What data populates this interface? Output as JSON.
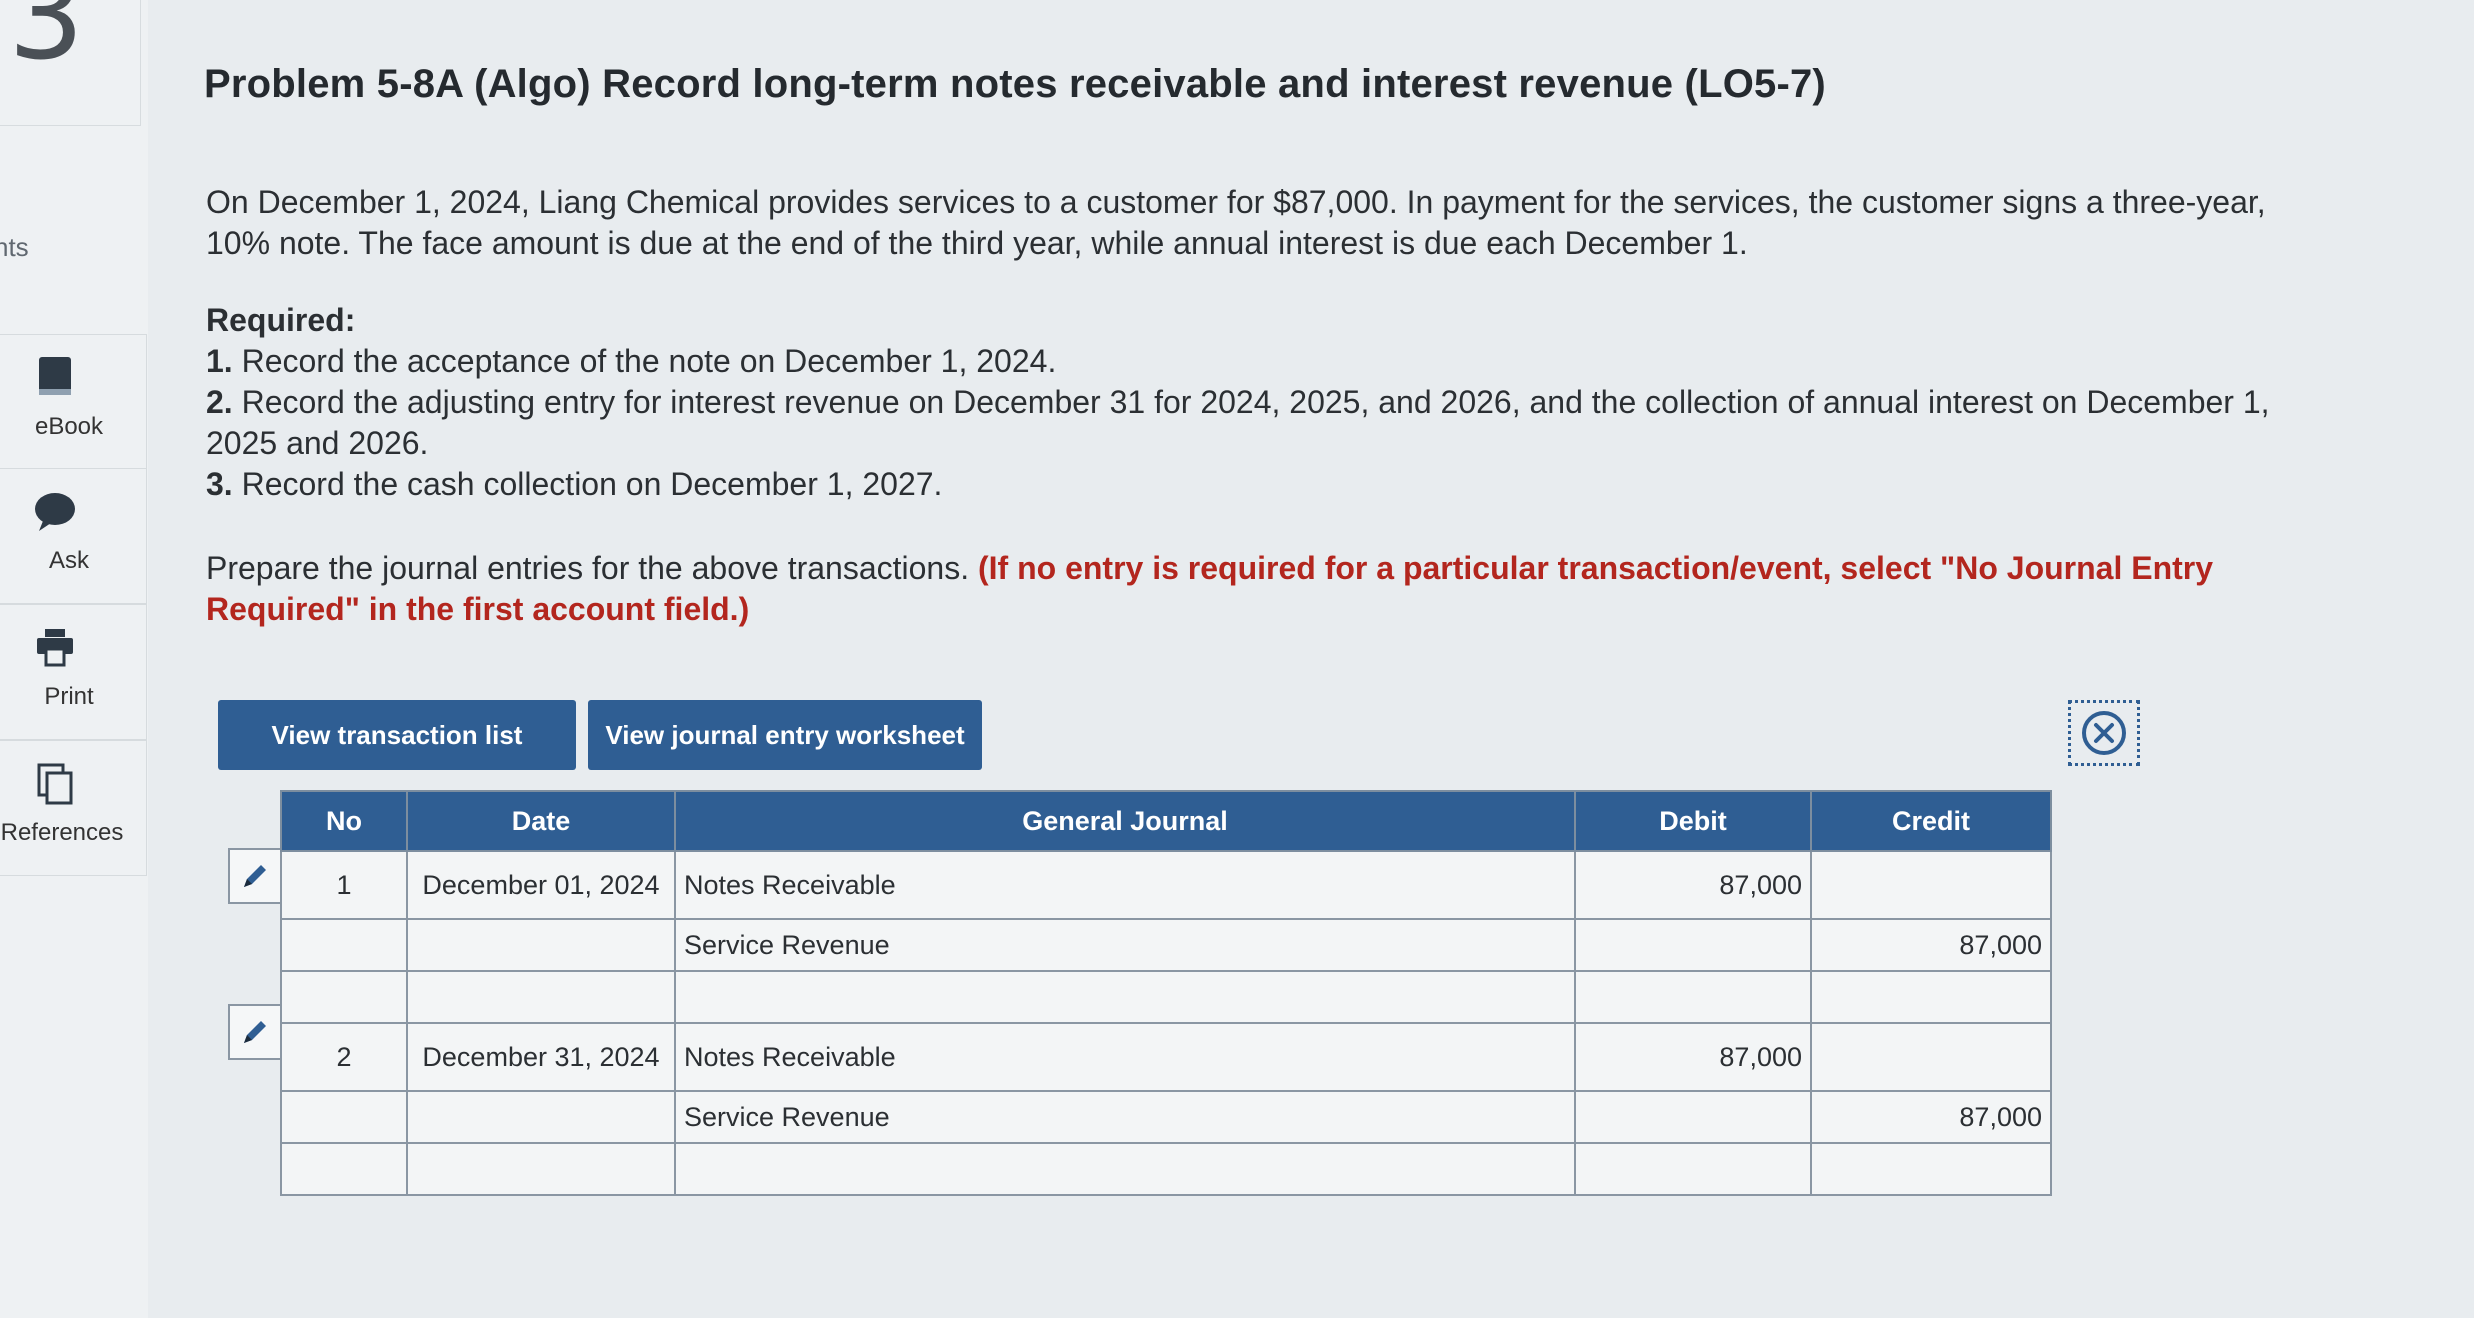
{
  "problem_number": "3",
  "rail": {
    "cut_label": "nts",
    "items": [
      {
        "label": "eBook",
        "icon": "book-icon"
      },
      {
        "label": "Ask",
        "icon": "chat-bubble-icon"
      },
      {
        "label": "Print",
        "icon": "printer-icon"
      },
      {
        "label": "References",
        "icon": "copy-pages-icon"
      }
    ]
  },
  "title": "Problem 5-8A (Algo) Record long-term notes receivable and interest revenue (LO5-7)",
  "intro": "On December 1, 2024, Liang Chemical provides services to a customer for $87,000. In payment for the services, the customer signs a three-year, 10% note. The face amount is due at the end of the third year, while annual interest is due each December 1.",
  "required": {
    "heading": "Required:",
    "items": [
      {
        "num": "1.",
        "text": "Record the acceptance of the note on December 1, 2024."
      },
      {
        "num": "2.",
        "text": "Record the adjusting entry for interest revenue on December 31 for 2024, 2025, and 2026, and the collection of annual interest on December 1, 2025 and 2026."
      },
      {
        "num": "3.",
        "text": "Record the cash collection on December 1, 2027."
      }
    ]
  },
  "instruction": {
    "text": "Prepare the journal entries for the above transactions.",
    "emphasis": "(If no entry is required for a particular transaction/event, select \"No Journal Entry Required\" in the first account field.)"
  },
  "buttons": {
    "transaction_list": "View transaction list",
    "journal_worksheet": "View journal entry worksheet"
  },
  "table": {
    "headers": {
      "no": "No",
      "date": "Date",
      "journal": "General Journal",
      "debit": "Debit",
      "credit": "Credit"
    },
    "rows": [
      {
        "no": "1",
        "date": "December 01, 2024",
        "account": "Notes Receivable",
        "debit": "87,000",
        "credit": ""
      },
      {
        "no": "",
        "date": "",
        "account": "Service Revenue",
        "debit": "",
        "credit": "87,000"
      },
      {
        "no": "",
        "date": "",
        "account": "",
        "debit": "",
        "credit": ""
      },
      {
        "no": "2",
        "date": "December 31, 2024",
        "account": "Notes Receivable",
        "debit": "87,000",
        "credit": ""
      },
      {
        "no": "",
        "date": "",
        "account": "Service Revenue",
        "debit": "",
        "credit": "87,000"
      },
      {
        "no": "",
        "date": "",
        "account": "",
        "debit": "",
        "credit": ""
      }
    ]
  },
  "colors": {
    "accent": "#2f5e93",
    "emphasis": "#b3261e"
  }
}
